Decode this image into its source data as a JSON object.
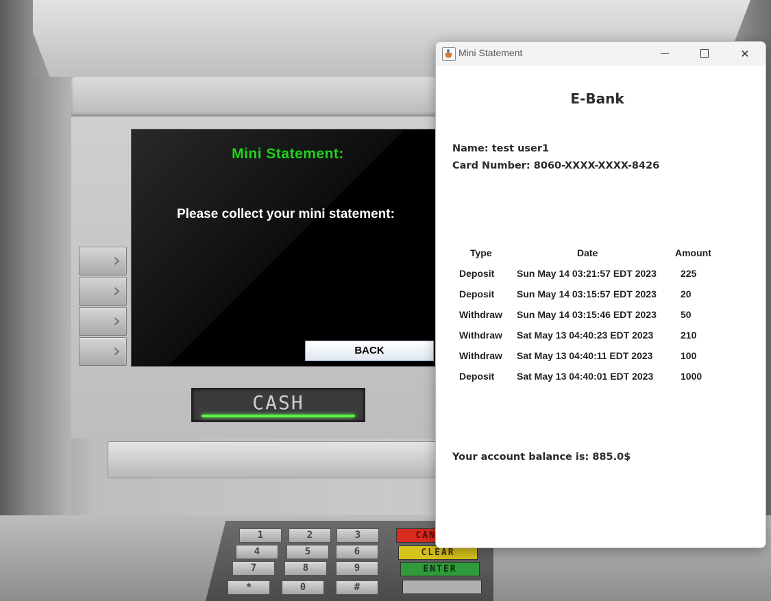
{
  "atm": {
    "screen": {
      "title": "Mini Statement:",
      "message": "Please collect your mini statement:",
      "back_label": "BACK"
    },
    "cash_label": "CASH",
    "keypad": {
      "keys": [
        "1",
        "2",
        "3",
        "4",
        "5",
        "6",
        "7",
        "8",
        "9",
        "*",
        "0",
        "#"
      ],
      "function_keys": [
        {
          "label": "CANCEL",
          "color": "#d82a1f"
        },
        {
          "label": "CLEAR",
          "color": "#d8c21c"
        },
        {
          "label": "ENTER",
          "color": "#2f9a3a"
        },
        {
          "label": "",
          "color": "#b0b0b0"
        }
      ]
    },
    "colors": {
      "title": "#21d21e",
      "cash_light": "#5cf04a"
    }
  },
  "window": {
    "title": "Mini Statement",
    "controls": {
      "minimize": "minimize-icon",
      "maximize": "maximize-icon",
      "close": "close-icon"
    },
    "bank_name": "E-Bank",
    "name_line": "Name: test user1",
    "card_line": "Card Number: 8060-XXXX-XXXX-8426",
    "table": {
      "headers": [
        "Type",
        "Date",
        "Amount"
      ],
      "rows": [
        [
          "Deposit",
          "Sun May 14 03:21:57 EDT 2023",
          "225"
        ],
        [
          "Deposit",
          "Sun May 14 03:15:57 EDT 2023",
          "20"
        ],
        [
          "Withdraw",
          "Sun May 14 03:15:46 EDT 2023",
          "50"
        ],
        [
          "Withdraw",
          "Sat May 13 04:40:23 EDT 2023",
          "210"
        ],
        [
          "Withdraw",
          "Sat May 13 04:40:11 EDT 2023",
          "100"
        ],
        [
          "Deposit",
          "Sat May 13 04:40:01 EDT 2023",
          "1000"
        ]
      ]
    },
    "balance_line": "Your account balance is: 885.0$"
  }
}
